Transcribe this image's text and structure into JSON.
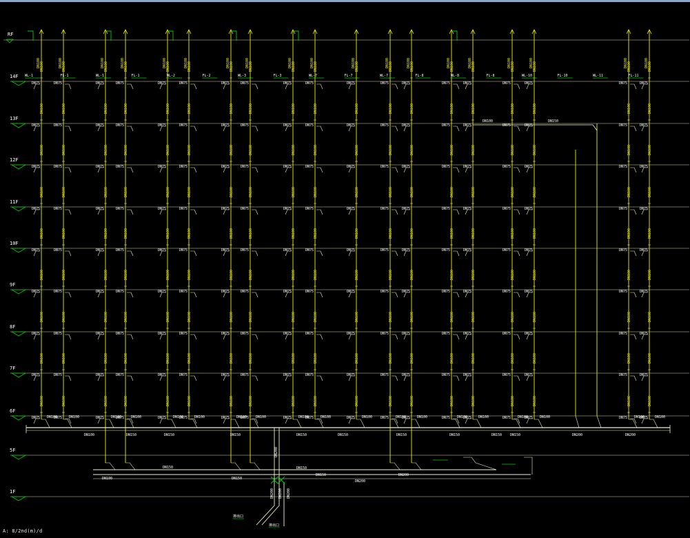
{
  "window": {
    "status_text": "A: 8/2nd(m)/d"
  },
  "colors": {
    "background": "#000000",
    "floor_line": "#d8d8a8",
    "riser": "#f0f000",
    "branch": "#f4f4c8",
    "marker": "#00cc00",
    "text": "#ffffff",
    "header": "#8ea6c8"
  },
  "diagram": {
    "top_marker_label": "RF",
    "floors": [
      {
        "label": "14F"
      },
      {
        "label": "13F"
      },
      {
        "label": "12F"
      },
      {
        "label": "11F"
      },
      {
        "label": "10F"
      },
      {
        "label": "9F"
      },
      {
        "label": "8F"
      },
      {
        "label": "7F"
      },
      {
        "label": "6F"
      },
      {
        "label": "5F"
      },
      {
        "label": "1F"
      }
    ],
    "riser_labels": [
      "WL-1",
      "FL-1",
      "WL-1",
      "FL-1",
      "WL-2",
      "FL-2",
      "WL-3",
      "FL-3",
      "WL-7",
      "FL-7",
      "WL-7",
      "FL-8",
      "WL-8",
      "FL-8",
      "WL-10",
      "FL-10",
      "WL-11",
      "FL-11"
    ],
    "pipe_size_small": "DN50",
    "pipe_size_mid": "DN75",
    "pipe_size_large": "DN100",
    "pipe_size_main": "DN150",
    "pipe_size_header": "DN200",
    "outlet_label_1": "排出口",
    "outlet_label_2": "排出口"
  }
}
